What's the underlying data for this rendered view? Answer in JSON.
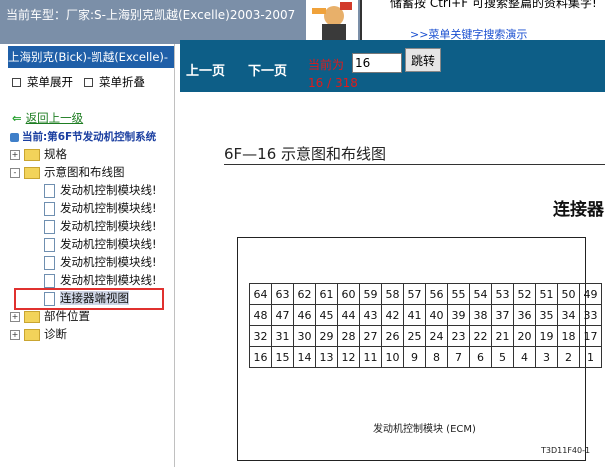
{
  "header": {
    "car_title": "当前车型：厂家:S-上海别克凯越(Excelle)2003-2007",
    "tip_text": "储蓄按  Ctrl+F   可搜索整篇的资料集字!",
    "tip_link": ">>菜单关键字搜索演示"
  },
  "sidebar": {
    "title": "上海别克(Bick)-凯越(Excelle)-",
    "expand_label": "菜单展开",
    "collapse_label": "菜单折叠",
    "back_label": "返回上一级",
    "current_label": "当前:第6F节发动机控制系统",
    "tree": [
      {
        "label": "规格",
        "type": "folder",
        "pm": "+"
      },
      {
        "label": "示意图和布线图",
        "type": "folder",
        "pm": "-"
      },
      {
        "label": "发动机控制模块线!",
        "type": "doc"
      },
      {
        "label": "发动机控制模块线!",
        "type": "doc"
      },
      {
        "label": "发动机控制模块线!",
        "type": "doc"
      },
      {
        "label": "发动机控制模块线!",
        "type": "doc"
      },
      {
        "label": "发动机控制模块线!",
        "type": "doc"
      },
      {
        "label": "发动机控制模块线!",
        "type": "doc"
      },
      {
        "label": "连接器端视图",
        "type": "doc",
        "selected": true
      },
      {
        "label": "部件位置",
        "type": "folder",
        "pm": "+"
      },
      {
        "label": "诊断",
        "type": "folder",
        "pm": "+"
      }
    ]
  },
  "pager": {
    "prev_label": "上一页",
    "next_label": "下一页",
    "current_label": "当前为",
    "page_value": "16",
    "jump_label": "跳转",
    "page_count": "16 / 318"
  },
  "document": {
    "section_title": "6F—16     示意图和布线图",
    "heading": "连接器",
    "pins_rows": [
      [
        "64",
        "63",
        "62",
        "61",
        "60",
        "59",
        "58",
        "57",
        "56",
        "55",
        "54",
        "53",
        "52",
        "51",
        "50",
        "49"
      ],
      [
        "48",
        "47",
        "46",
        "45",
        "44",
        "43",
        "42",
        "41",
        "40",
        "39",
        "38",
        "37",
        "36",
        "35",
        "34",
        "33"
      ],
      [
        "32",
        "31",
        "30",
        "29",
        "28",
        "27",
        "26",
        "25",
        "24",
        "23",
        "22",
        "21",
        "20",
        "19",
        "18",
        "17"
      ],
      [
        "16",
        "15",
        "14",
        "13",
        "12",
        "11",
        "10",
        "9",
        "8",
        "7",
        "6",
        "5",
        "4",
        "3",
        "2",
        "1"
      ]
    ],
    "module_label": "发动机控制模块 (ECM)",
    "figure_code": "T3D11F40-1"
  },
  "colors": {
    "nav_bar": "#0d5e87",
    "sidebar_header": "#1f5fa8",
    "highlight": "#e0312f"
  }
}
